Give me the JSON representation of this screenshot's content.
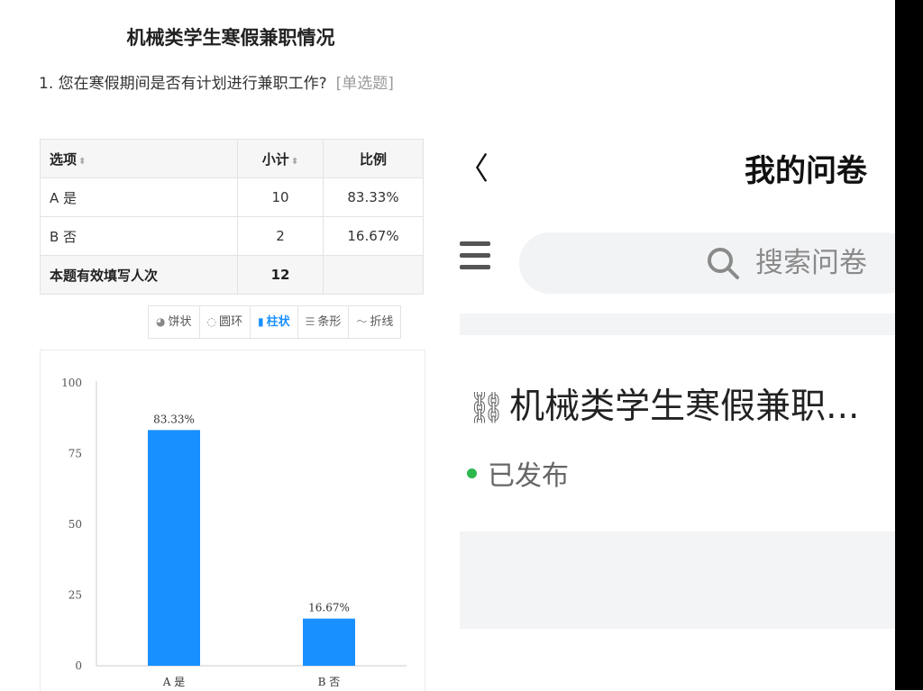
{
  "report": {
    "title": "机械类学生寒假兼职情况",
    "question": "1. 您在寒假期间是否有计划进行兼职工作?",
    "question_type": "[单选题]",
    "table": {
      "headers": [
        "选项",
        "小计",
        "比例"
      ],
      "rows": [
        {
          "option": "A 是",
          "count": "10",
          "ratio": "83.33%"
        },
        {
          "option": "B 否",
          "count": "2",
          "ratio": "16.67%"
        }
      ],
      "total_label": "本题有效填写人次",
      "total_count": "12"
    },
    "chart_tabs": [
      {
        "label": "饼状",
        "icon": "pie-icon"
      },
      {
        "label": "圆环",
        "icon": "ring-icon"
      },
      {
        "label": "柱状",
        "icon": "bar-icon",
        "active": true
      },
      {
        "label": "条形",
        "icon": "hbar-icon"
      },
      {
        "label": "折线",
        "icon": "line-icon"
      }
    ]
  },
  "chart_data": {
    "type": "bar",
    "categories": [
      "A 是",
      "B 否"
    ],
    "values": [
      83.33,
      16.67
    ],
    "data_labels": [
      "83.33%",
      "16.67%"
    ],
    "ylim": [
      0,
      100
    ],
    "yticks": [
      "0",
      "25",
      "50",
      "75",
      "100"
    ],
    "bar_color": "#1890ff"
  },
  "mobile": {
    "back_symbol": "〈",
    "title": "我的问卷",
    "search_placeholder": "搜索问卷",
    "survey_title": "机械类学生寒假兼职...",
    "status": "已发布",
    "status_color": "#2db84d"
  }
}
